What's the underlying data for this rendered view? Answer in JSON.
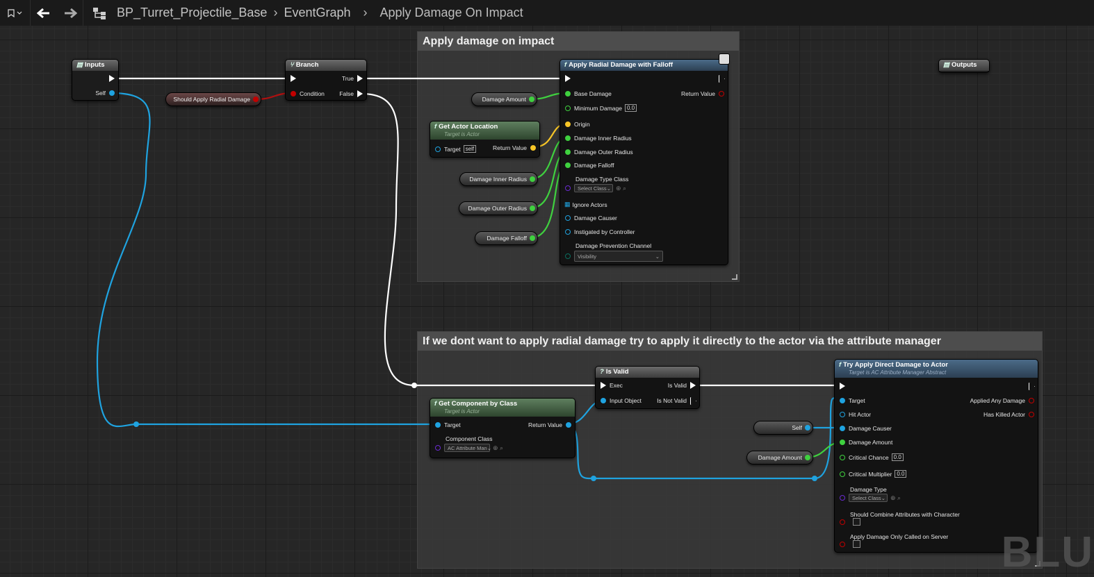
{
  "breadcrumb": {
    "blueprint": "BP_Turret_Projectile_Base",
    "graph": "EventGraph",
    "function": "Apply Damage On Impact"
  },
  "comments": {
    "radial": "Apply damage on impact",
    "direct": "If we dont want to apply radial damage try to apply it directly to the actor via the attribute manager"
  },
  "inputs": {
    "title": "Inputs",
    "self": "Self"
  },
  "outputs": {
    "title": "Outputs"
  },
  "branch": {
    "title": "Branch",
    "condition": "Condition",
    "true": "True",
    "false": "False"
  },
  "vars": {
    "should_apply": "Should Apply Radial Damage",
    "damage_amount": "Damage Amount",
    "inner": "Damage Inner Radius",
    "outer": "Damage Outer Radius",
    "falloff": "Damage Falloff",
    "self": "Self",
    "damage_amount2": "Damage Amount"
  },
  "get_actor_location": {
    "title": "Get Actor Location",
    "sub": "Target is Actor",
    "target": "Target",
    "self_val": "self",
    "return": "Return Value"
  },
  "radial": {
    "title": "Apply Radial Damage with Falloff",
    "base": "Base Damage",
    "min": "Minimum Damage",
    "min_val": "0.0",
    "origin": "Origin",
    "inner": "Damage Inner Radius",
    "outer": "Damage Outer Radius",
    "falloff": "Damage Falloff",
    "type": "Damage Type Class",
    "type_sel": "Select Class",
    "ignore": "Ignore Actors",
    "causer": "Damage Causer",
    "instigator": "Instigated by Controller",
    "channel": "Damage Prevention Channel",
    "channel_val": "Visibility",
    "return": "Return Value"
  },
  "is_valid": {
    "title": "Is Valid",
    "exec": "Exec",
    "input": "Input Object",
    "valid": "Is Valid",
    "not_valid": "Is Not Valid"
  },
  "get_component": {
    "title": "Get Component by Class",
    "sub": "Target is Actor",
    "target": "Target",
    "return": "Return Value",
    "class": "Component Class",
    "class_val": "AC Attribute Man"
  },
  "try_apply": {
    "title": "Try Apply Direct Damage to Actor",
    "sub": "Target is AC Attribute Manager Abstract",
    "target": "Target",
    "hit": "Hit Actor",
    "causer": "Damage Causer",
    "amount": "Damage Amount",
    "crit_chance": "Critical Chance",
    "crit_chance_val": "0.0",
    "crit_mult": "Critical Multiplier",
    "crit_mult_val": "0.0",
    "dtype": "Damage Type",
    "dtype_sel": "Select Class",
    "combine": "Should Combine Attributes with Character",
    "server": "Apply Damage Only Called on Server",
    "applied": "Applied Any Damage",
    "killed": "Has Killed Actor"
  },
  "watermark": "BLU",
  "colors": {
    "exec": "#ffffff",
    "object": "#1fa3e0",
    "float": "#3fd13f",
    "bool": "#c20000",
    "vector": "#f7c527",
    "class": "#6a2bd3",
    "array": "#1fa3e0",
    "enum": "#0a6e5e"
  }
}
